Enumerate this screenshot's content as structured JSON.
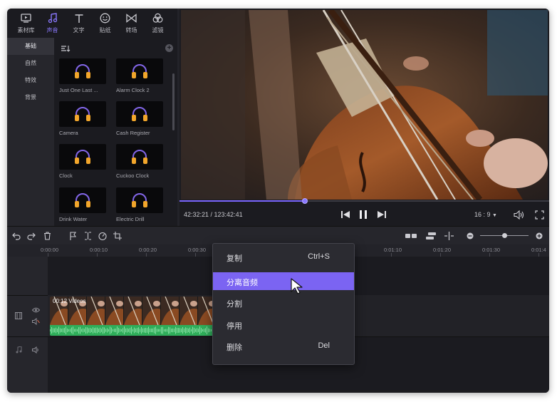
{
  "tabs": [
    {
      "label": "素材库",
      "icon": "media-library-icon"
    },
    {
      "label": "声音",
      "icon": "music-note-icon",
      "active": true
    },
    {
      "label": "文字",
      "icon": "text-icon"
    },
    {
      "label": "贴纸",
      "icon": "sticker-icon"
    },
    {
      "label": "转场",
      "icon": "transition-icon"
    },
    {
      "label": "滤镜",
      "icon": "filter-icon"
    }
  ],
  "categories": [
    {
      "label": "基础",
      "active": true
    },
    {
      "label": "自然"
    },
    {
      "label": "特效"
    },
    {
      "label": "背景"
    }
  ],
  "sounds": [
    "Just One Last ...",
    "Alarm Clock 2",
    "Camera",
    "Cash Register",
    "Clock",
    "Cuckoo Clock",
    "Drink Water",
    "Electric Drill"
  ],
  "player": {
    "timecode": "42:32:21 / 123:42:41",
    "progress": 0.34,
    "aspect_ratio": "16 : 9",
    "accent_color": "#7a66ff"
  },
  "ruler": {
    "ticks": [
      "0:00:00",
      "0:00:10",
      "0:00:20",
      "0:00:30",
      "0:01:10",
      "0:01:20",
      "0:01:30",
      "0:01:4"
    ]
  },
  "clip": {
    "label": "00:12  Videos",
    "wave_color": "#2fae5a"
  },
  "context_menu": {
    "items": [
      {
        "label": "复制",
        "shortcut": "Ctrl+S"
      },
      {
        "label": "分离音频",
        "shortcut": "",
        "highlighted": true
      },
      {
        "label": "分割",
        "shortcut": ""
      },
      {
        "label": "停用",
        "shortcut": ""
      },
      {
        "label": "删除",
        "shortcut": "Del"
      }
    ],
    "highlight_color": "#7b64f2"
  }
}
